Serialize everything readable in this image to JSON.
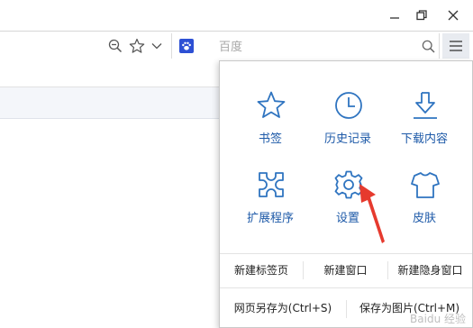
{
  "window": {
    "controls": [
      "minimize-icon",
      "restore-icon",
      "close-icon"
    ]
  },
  "toolbar": {
    "icons": [
      "zoom-icon",
      "star-icon",
      "chevron-down-icon",
      "paw-icon",
      "search-icon",
      "menu-icon"
    ],
    "search": {
      "placeholder": "百度"
    }
  },
  "menu": {
    "grid": [
      {
        "label": "书签",
        "icon": "star-outline-icon"
      },
      {
        "label": "历史记录",
        "icon": "clock-icon"
      },
      {
        "label": "下载内容",
        "icon": "download-icon"
      },
      {
        "label": "扩展程序",
        "icon": "extensions-icon"
      },
      {
        "label": "设置",
        "icon": "gear-icon"
      },
      {
        "label": "皮肤",
        "icon": "shirt-icon"
      }
    ],
    "row1": [
      "新建标签页",
      "新建窗口",
      "新建隐身窗口"
    ],
    "row2": [
      "网页另存为(Ctrl+S)",
      "保存为图片(Ctrl+M)"
    ]
  },
  "colors": {
    "accent": "#2f74c0",
    "label": "#1e5aa8",
    "arrow": "#e63a2e"
  },
  "watermark": "Baidu 经验"
}
